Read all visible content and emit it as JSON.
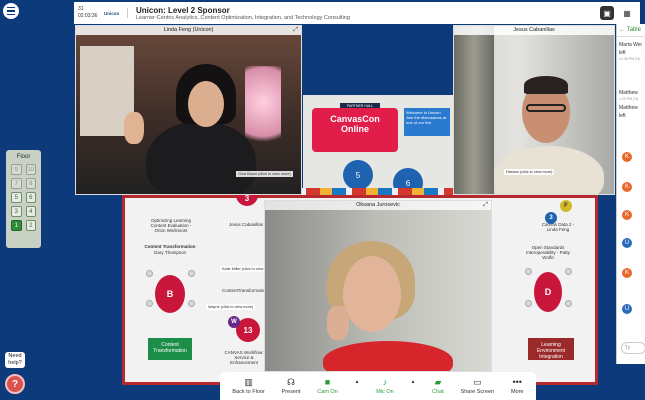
{
  "header": {
    "count_top": "31",
    "timer": "02:03:36",
    "logo_text": "Unicon",
    "title": "Unicon: Level 2 Sponsor",
    "subtitle": "Learner-Centric Analytics, Content Optimization, Integration, and Technology Consulting"
  },
  "floor": {
    "title": "Floor",
    "cells": [
      "9",
      "10",
      "7",
      "8",
      "5",
      "6",
      "3",
      "4",
      "1",
      "2"
    ]
  },
  "help": {
    "label": "Need help?",
    "badge": "?"
  },
  "videos": {
    "linda": {
      "name": "Linda Feng (Unicon)",
      "caption": "Gina Bauer (click to view more)"
    },
    "jesus": {
      "name": "Jesus Cabanillas",
      "caption": "Hassan (click to view more)"
    },
    "oksana": {
      "name": "Oksana Jurosevic"
    }
  },
  "stage": {
    "partner_hall": "PARTNER HALL",
    "sign_line1": "CanvasCon",
    "sign_line2": "Online",
    "welcome": "Welcome to Unicon",
    "welcome_sub": "Join the discussions at one of our five"
  },
  "tables": {
    "optimizing_label": "Optimizing Learning Content Evaluation - Orion Wielinsont",
    "content_transformation": "Content Transformation",
    "content_transformation_host": "Gary Thompson",
    "jesus_tag": "Jesus Cabanillas",
    "content_transformation_short": "ContentTransformation",
    "katie_tag": "Katie Miller (click to view more)",
    "wayne_tag": "Wayne (click to view more)",
    "canvas_tag": "CANVAS Workflow: Service & Enhancement",
    "canvas_data_tag": "Canvas Data 2 - Linda Feng",
    "open_standards": "Open Standards Interoperability - Patty Wolfe",
    "learning_env": "Learning Environment Integration",
    "content_transformation_sign": "Content Transformation",
    "disc_b": "B",
    "disc_d": "D",
    "disc_3": "3",
    "disc_13": "13",
    "disc_5": "5",
    "disc_6": "6",
    "disc_f": "F"
  },
  "chat": {
    "header": "Table",
    "lines": [
      "Marta Wie",
      "left",
      "12:38 PM (%)",
      "Matthew",
      "1:20 PM (%)",
      "Matthew",
      "left"
    ],
    "avatar_k": "K",
    "avatar_u": "U",
    "input_placeholder": "Ty"
  },
  "toolbar": {
    "back": "Back to Floor",
    "present": "Present",
    "cam": "Cam On",
    "mic": "Mic On",
    "chat": "Chat",
    "share": "Share Screen",
    "more": "More"
  },
  "colors": {
    "background": "#0d3a7a",
    "accent_green": "#2a9a3a",
    "canvas_red": "#e11d4a",
    "table_red": "#c8173a"
  }
}
